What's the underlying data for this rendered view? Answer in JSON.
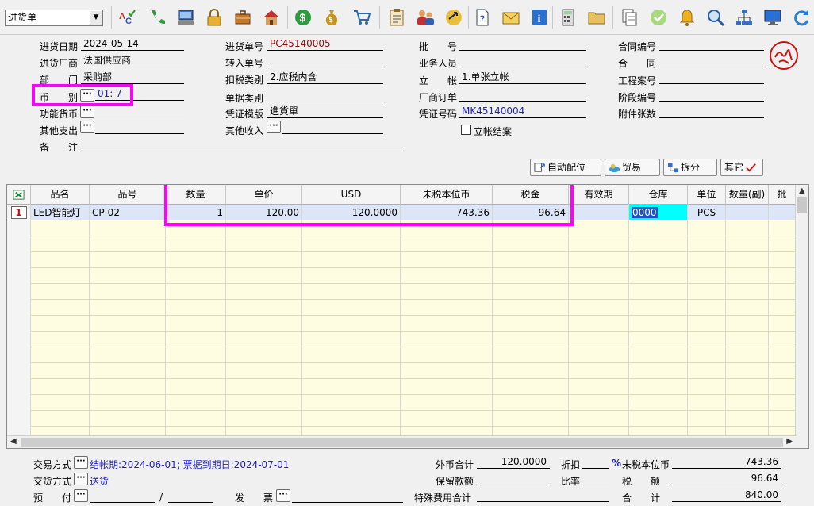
{
  "toolbar": {
    "doc_type": "进货单",
    "icons": [
      "spellcheck-icon",
      "phone-icon",
      "computer-icon",
      "lock-icon",
      "briefcase-icon",
      "home-icon",
      "dollar-icon",
      "money-bag-icon",
      "cart-icon",
      "clipboard-icon",
      "users-icon",
      "exchange-icon",
      "help-doc-icon",
      "mail-icon",
      "info-icon",
      "calculator-icon",
      "folder-icon",
      "documents-icon",
      "check-icon",
      "bell-icon",
      "search-icon",
      "org-chart-icon",
      "monitor-icon",
      "refresh-icon"
    ]
  },
  "header": {
    "purchase_date_label": "进货日期",
    "purchase_date": "2024-05-14",
    "supplier_label": "进货厂商",
    "supplier": "法国供应商",
    "department_label": "部　　门",
    "department": "采购部",
    "currency_label": "币　　别",
    "currency": "01: 7",
    "func_currency_label": "功能货币",
    "other_expense_label": "其他支出",
    "remark_label": "备　　注",
    "doc_no_label": "进货单号",
    "doc_no": "PC45140005",
    "transfer_no_label": "转入单号",
    "tax_type_label": "扣税类别",
    "tax_type": "2.应税内含",
    "bill_type_label": "单据类别",
    "voucher_template_label": "凭证模版",
    "voucher_template": "進貨單",
    "other_income_label": "其他收入",
    "batch_no_label": "批　　号",
    "salesperson_label": "业务人员",
    "account_label": "立　　帐",
    "account": "1.单张立帐",
    "vendor_order_label": "厂商订单",
    "voucher_no_label": "凭证号码",
    "voucher_no": "MK45140004",
    "settle_label": "立帐结案",
    "contract_no_label": "合同编号",
    "contract_label": "合　　同",
    "project_no_label": "工程案号",
    "phase_no_label": "阶段编号",
    "attachments_label": "附件张数",
    "stamp_color": "#cc1111"
  },
  "actions": {
    "auto_locate": "自动配位",
    "trade": "贸易",
    "split": "拆分",
    "other": "其它"
  },
  "grid": {
    "columns": [
      "品名",
      "品号",
      "数量",
      "单价",
      "USD",
      "未税本位币",
      "税金",
      "有效期",
      "仓库",
      "单位",
      "数量(副)",
      "批"
    ],
    "rows": [
      {
        "row_no": "1",
        "name": "LED智能灯",
        "code": "CP-02",
        "qty": "1",
        "price": "120.00",
        "usd": "120.0000",
        "untaxed": "743.36",
        "tax": "96.64",
        "expiry": "",
        "warehouse": "0000",
        "unit": "PCS",
        "qty2": ""
      }
    ]
  },
  "footer": {
    "trade_method_label": "交易方式",
    "trade_method": "结帐期:2024-06-01; 票据到期日:2024-07-01",
    "delivery_method_label": "交货方式",
    "delivery_method": "送货",
    "prepay_label": "预　　付",
    "prepay_sep": "/",
    "invoice_label": "发　　票",
    "foreign_total_label": "外币合计",
    "foreign_total": "120.0000",
    "retention_label": "保留款额",
    "special_fee_label": "特殊费用合计",
    "discount_label": "折扣",
    "discount_unit": "%",
    "ratio_label": "比率",
    "untaxed_total_label": "未税本位币",
    "untaxed_total": "743.36",
    "tax_label": "税　　额",
    "tax_total": "96.64",
    "total_label": "合　　计",
    "grand_total": "840.00"
  },
  "colors": {
    "highlight": "#ff00ff",
    "grid_bg": "#fffde1",
    "selected_cell": "#00ffff"
  }
}
